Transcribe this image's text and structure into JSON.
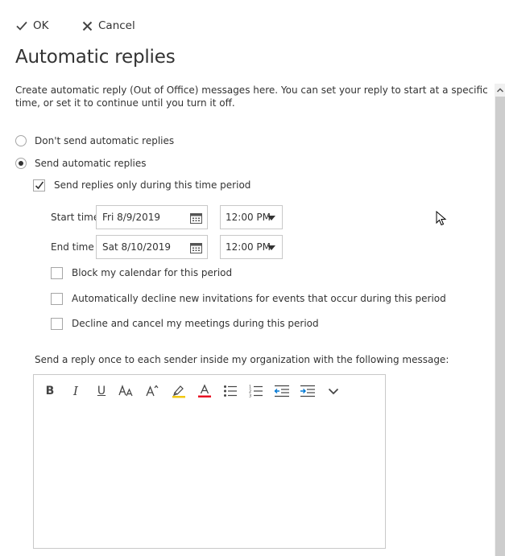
{
  "toolbar": {
    "ok_label": "OK",
    "cancel_label": "Cancel"
  },
  "page": {
    "title": "Automatic replies",
    "description": "Create automatic reply (Out of Office) messages here. You can set your reply to start at a specific time, or set it to continue until you turn it off."
  },
  "options": {
    "dont_send": {
      "label": "Don't send automatic replies",
      "selected": false
    },
    "send": {
      "label": "Send automatic replies",
      "selected": true
    },
    "time_period": {
      "label": "Send replies only during this time period",
      "checked": true
    }
  },
  "schedule": {
    "start_label": "Start time",
    "start_date": "Fri 8/9/2019",
    "start_time": "12:00 PM",
    "end_label": "End time",
    "end_date": "Sat 8/10/2019",
    "end_time": "12:00 PM"
  },
  "extras": {
    "block_calendar": {
      "label": "Block my calendar for this period",
      "checked": false
    },
    "decline_invitations": {
      "label": "Automatically decline new invitations for events that occur during this period",
      "checked": false
    },
    "decline_cancel": {
      "label": "Decline and cancel my meetings during this period",
      "checked": false
    }
  },
  "message": {
    "label": "Send a reply once to each sender inside my organization with the following message:",
    "body": ""
  },
  "format_toolbar": {
    "icons": [
      "bold-icon",
      "italic-icon",
      "underline-icon",
      "font-size-icon",
      "grow-font-icon",
      "highlight-icon",
      "font-color-icon",
      "bullets-icon",
      "numbering-icon",
      "decrease-indent-icon",
      "increase-indent-icon",
      "more-options-icon"
    ]
  },
  "colors": {
    "highlight": "#f2c811",
    "font_color": "#e81123",
    "accent": "#0078d4"
  }
}
